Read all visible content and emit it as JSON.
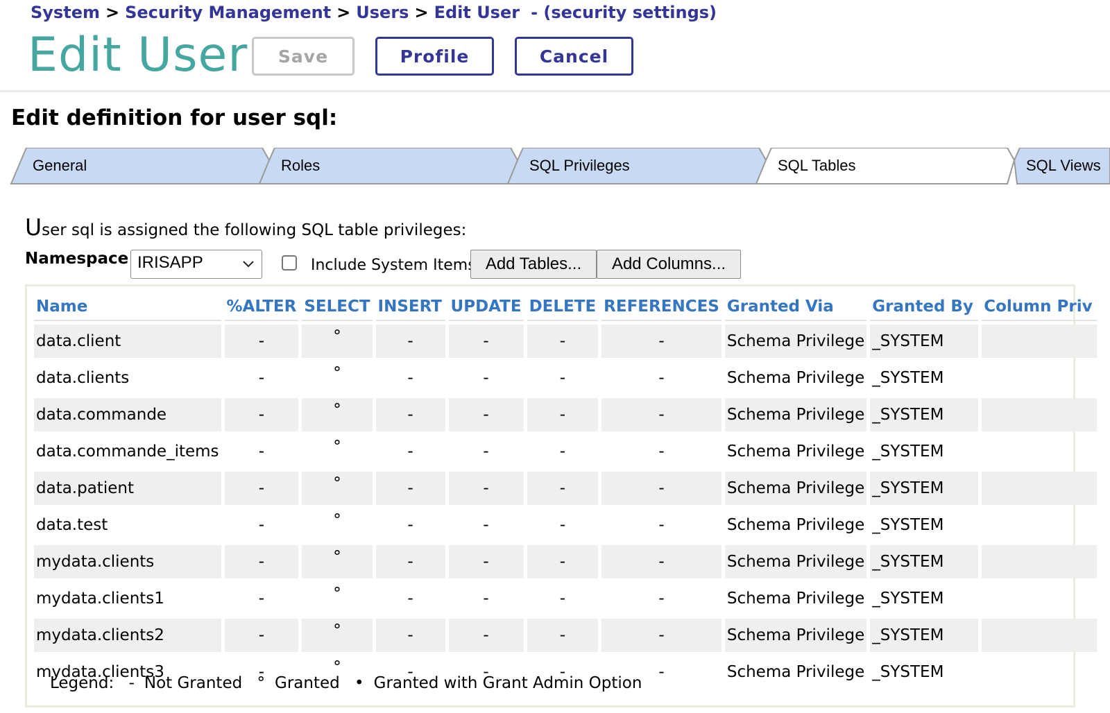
{
  "breadcrumb": {
    "items": [
      "System",
      "Security Management",
      "Users",
      "Edit User"
    ],
    "separator": ">",
    "suffix": "- (security settings)"
  },
  "page_title": "Edit User",
  "toolbar": {
    "save_label": "Save",
    "profile_label": "Profile",
    "cancel_label": "Cancel"
  },
  "section_title": "Edit definition for user sql:",
  "tabs": [
    {
      "label": "General",
      "active": false
    },
    {
      "label": "Roles",
      "active": false
    },
    {
      "label": "SQL Privileges",
      "active": false
    },
    {
      "label": "SQL Tables",
      "active": true
    },
    {
      "label": "SQL Views",
      "active": false
    }
  ],
  "intro": {
    "first_letter": "U",
    "rest": "ser sql is assigned the following SQL table privileges:"
  },
  "namespace": {
    "label": "Namespace",
    "value": "IRISAPP"
  },
  "include_system": {
    "label": "Include System Items",
    "checked": false
  },
  "actions": {
    "add_tables": "Add Tables...",
    "add_columns": "Add Columns..."
  },
  "table": {
    "headers": [
      "Name",
      "%ALTER",
      "SELECT",
      "INSERT",
      "UPDATE",
      "DELETE",
      "REFERENCES",
      "Granted Via",
      "Granted By",
      "Column Priv"
    ],
    "rows": [
      [
        "data.client",
        "-",
        "°",
        "-",
        "-",
        "-",
        "-",
        "Schema Privilege",
        "_SYSTEM",
        ""
      ],
      [
        "data.clients",
        "-",
        "°",
        "-",
        "-",
        "-",
        "-",
        "Schema Privilege",
        "_SYSTEM",
        ""
      ],
      [
        "data.commande",
        "-",
        "°",
        "-",
        "-",
        "-",
        "-",
        "Schema Privilege",
        "_SYSTEM",
        ""
      ],
      [
        "data.commande_items",
        "-",
        "°",
        "-",
        "-",
        "-",
        "-",
        "Schema Privilege",
        "_SYSTEM",
        ""
      ],
      [
        "data.patient",
        "-",
        "°",
        "-",
        "-",
        "-",
        "-",
        "Schema Privilege",
        "_SYSTEM",
        ""
      ],
      [
        "data.test",
        "-",
        "°",
        "-",
        "-",
        "-",
        "-",
        "Schema Privilege",
        "_SYSTEM",
        ""
      ],
      [
        "mydata.clients",
        "-",
        "°",
        "-",
        "-",
        "-",
        "-",
        "Schema Privilege",
        "_SYSTEM",
        ""
      ],
      [
        "mydata.clients1",
        "-",
        "°",
        "-",
        "-",
        "-",
        "-",
        "Schema Privilege",
        "_SYSTEM",
        ""
      ],
      [
        "mydata.clients2",
        "-",
        "°",
        "-",
        "-",
        "-",
        "-",
        "Schema Privilege",
        "_SYSTEM",
        ""
      ],
      [
        "mydata.clients3",
        "-",
        "°",
        "-",
        "-",
        "-",
        "-",
        "Schema Privilege",
        "_SYSTEM",
        ""
      ]
    ]
  },
  "legend": {
    "label": "Legend:",
    "items": [
      {
        "symbol": "-",
        "text": "Not Granted"
      },
      {
        "symbol": "°",
        "text": "Granted"
      },
      {
        "symbol": "•",
        "text": "Granted with Grant Admin Option"
      }
    ]
  },
  "colors": {
    "breadcrumb": "#333695",
    "title": "#46a7a1",
    "tab_inactive": "#c8d9f4",
    "table_header": "#3576c1",
    "row_shade": "#efefef"
  }
}
